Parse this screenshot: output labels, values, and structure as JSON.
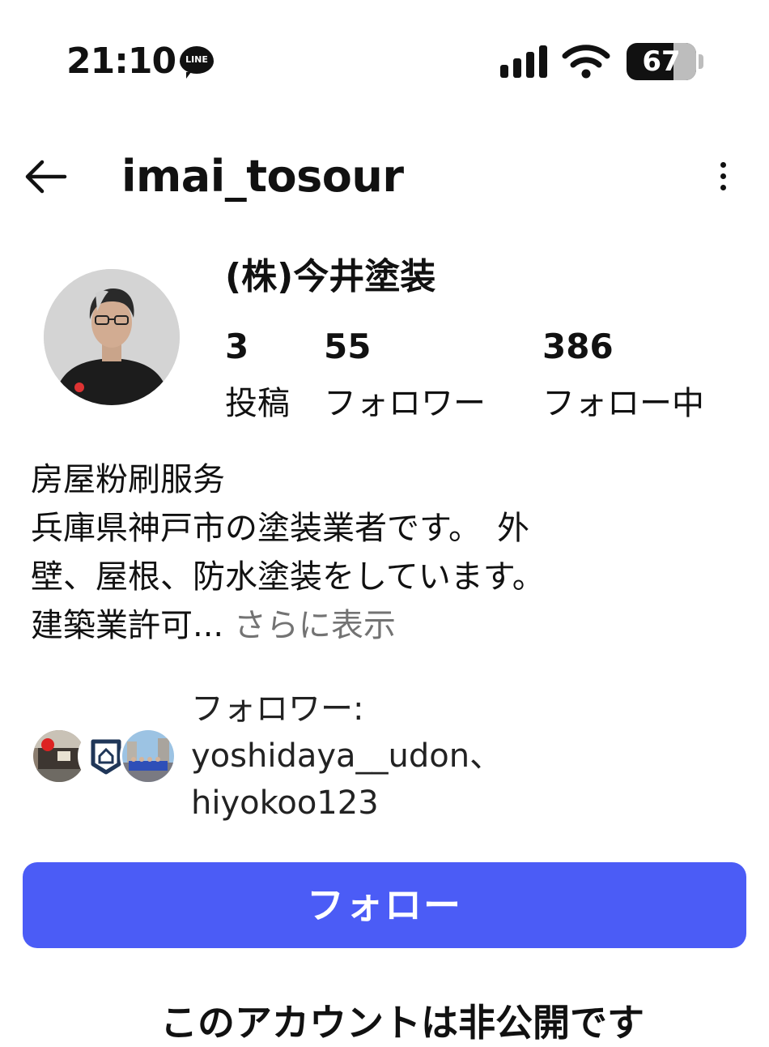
{
  "status_bar": {
    "time": "21:10",
    "line_label": "LINE",
    "battery": "67",
    "battery_level": 0.67
  },
  "header": {
    "username": "imai_tosour"
  },
  "profile": {
    "display_name": "(株)今井塗装",
    "stats": [
      {
        "value": "3",
        "label": "投稿"
      },
      {
        "value": "55",
        "label": "フォロワー"
      },
      {
        "value": "386",
        "label": "フォロー中"
      }
    ],
    "bio_lines": [
      "房屋粉刷服务",
      "兵庫県神戸市の塗装業者です。　外",
      "壁、屋根、防水塗装をしています。",
      "建築業許可..."
    ],
    "more_label": "さらに表示"
  },
  "followed_by": {
    "heading": "フォロワー:",
    "line1": "yoshidaya__udon、",
    "line2": "hiyokoo123"
  },
  "follow_button": "フォロー",
  "private_notice": "このアカウントは非公開です",
  "colors": {
    "accent": "#4b5cf6",
    "text": "#111111",
    "muted": "#737373"
  }
}
